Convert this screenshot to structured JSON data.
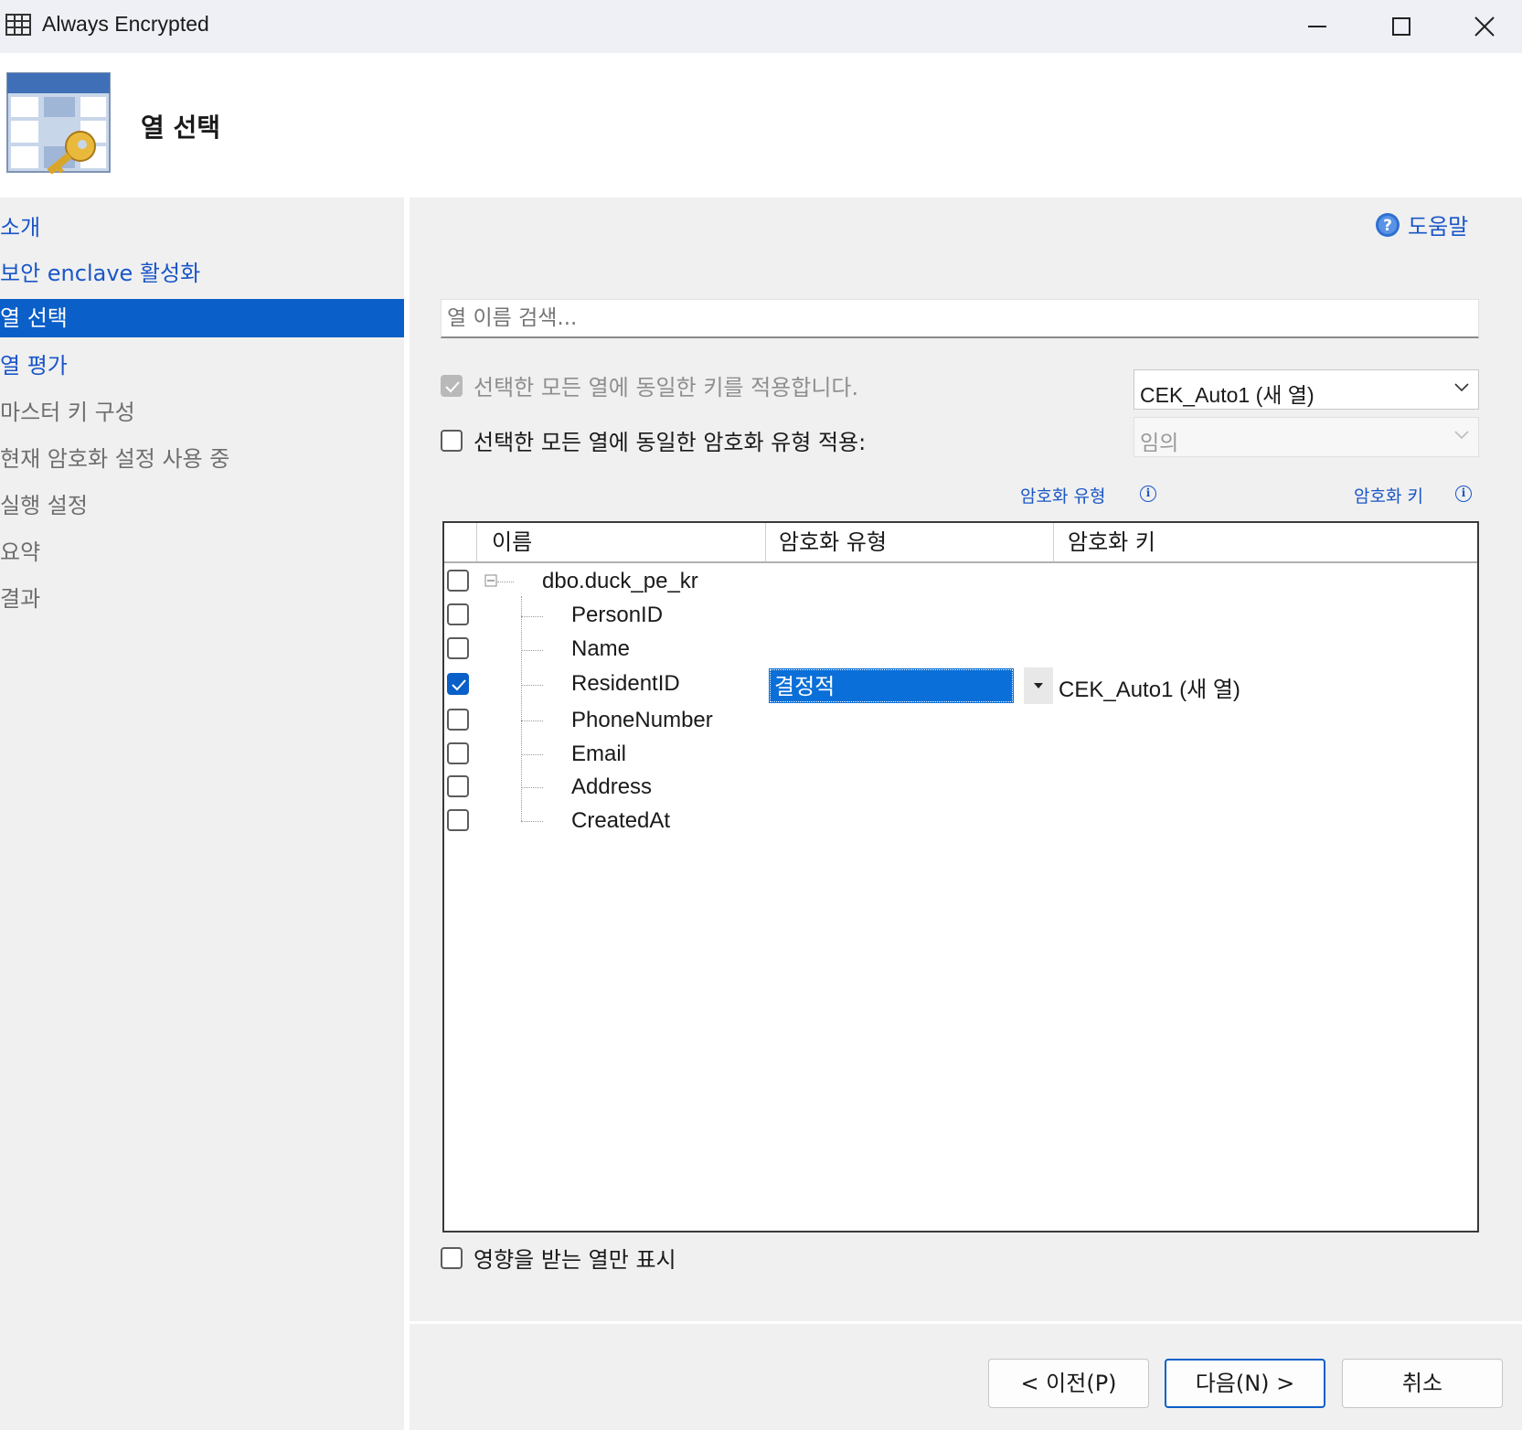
{
  "window": {
    "title": "Always Encrypted"
  },
  "header": {
    "title": "열 선택"
  },
  "sidebar": {
    "items": [
      {
        "label": "소개",
        "state": "link"
      },
      {
        "label": "보안 enclave 활성화",
        "state": "link"
      },
      {
        "label": "열 선택",
        "state": "active"
      },
      {
        "label": "열 평가",
        "state": "link"
      },
      {
        "label": "마스터 키 구성",
        "state": "disabled"
      },
      {
        "label": "현재 암호화 설정 사용 중",
        "state": "disabled"
      },
      {
        "label": "실행 설정",
        "state": "disabled"
      },
      {
        "label": "요약",
        "state": "disabled"
      },
      {
        "label": "결과",
        "state": "disabled"
      }
    ]
  },
  "help": {
    "label": "도움말",
    "icon": "help-circle-icon"
  },
  "search": {
    "placeholder": "열 이름 검색..."
  },
  "options": {
    "same_key_label": "선택한 모든 열에 동일한 키를 적용합니다.",
    "same_key_checked": true,
    "same_key_enabled": false,
    "key_combo_value": "CEK_Auto1 (새 열)",
    "same_type_label": "선택한 모든 열에 동일한 암호화 유형 적용:",
    "same_type_checked": false,
    "type_combo_value": "임의"
  },
  "info_links": {
    "enc_type": "암호화 유형",
    "enc_key": "암호화 키"
  },
  "grid": {
    "columns": [
      "이름",
      "암호화 유형",
      "암호화 키"
    ],
    "table": {
      "name": "dbo.duck_pe_kr",
      "checked": false
    },
    "rows": [
      {
        "name": "PersonID",
        "checked": false,
        "enc_type": "",
        "enc_key": ""
      },
      {
        "name": "Name",
        "checked": false,
        "enc_type": "",
        "enc_key": ""
      },
      {
        "name": "ResidentID",
        "checked": true,
        "enc_type": "결정적",
        "enc_key": "CEK_Auto1 (새 열)"
      },
      {
        "name": "PhoneNumber",
        "checked": false,
        "enc_type": "",
        "enc_key": ""
      },
      {
        "name": "Email",
        "checked": false,
        "enc_type": "",
        "enc_key": ""
      },
      {
        "name": "Address",
        "checked": false,
        "enc_type": "",
        "enc_key": ""
      },
      {
        "name": "CreatedAt",
        "checked": false,
        "enc_type": "",
        "enc_key": ""
      }
    ]
  },
  "affected_only": {
    "label": "영향을 받는 열만 표시",
    "checked": false
  },
  "footer": {
    "prev_label": "< 이전(P)",
    "next_label": "다음(N) >",
    "cancel_label": "취소"
  },
  "colors": {
    "accent": "#0a5fc8",
    "link": "#1a56c8",
    "selection": "#0a6fd8"
  }
}
